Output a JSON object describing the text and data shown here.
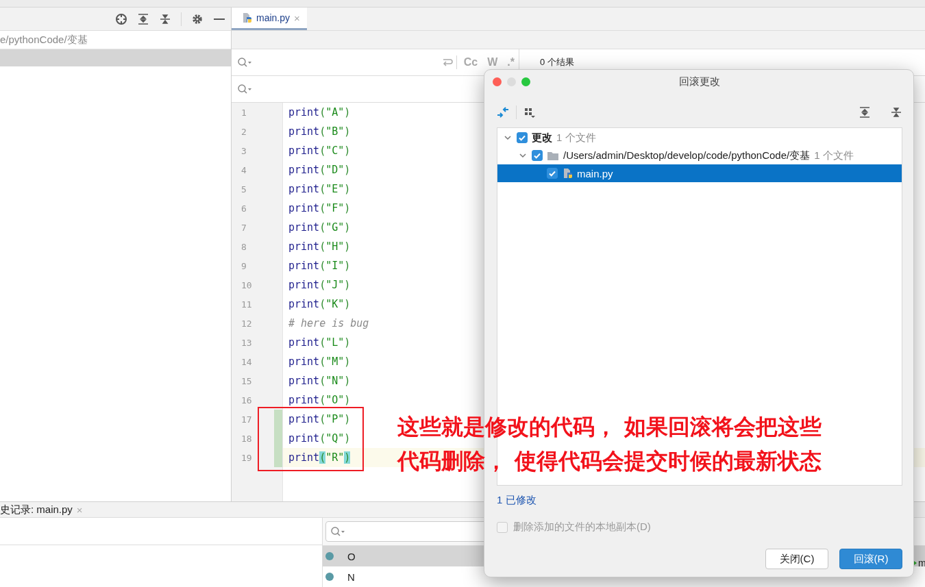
{
  "project_panel": {
    "breadcrumb": "e/pythonCode/变基"
  },
  "editor_tabs": [
    {
      "label": "main.py",
      "close_glyph": "×",
      "selected": true
    }
  ],
  "find_bar": {
    "toggles": [
      "Cc",
      "W",
      ".*"
    ],
    "result": "0 个结果"
  },
  "editor": {
    "lines": [
      {
        "number": "1",
        "kind": "code",
        "text": "print(\"A\")",
        "changed": false,
        "current": false,
        "brace_match": false
      },
      {
        "number": "2",
        "kind": "code",
        "text": "print(\"B\")",
        "changed": false,
        "current": false,
        "brace_match": false
      },
      {
        "number": "3",
        "kind": "code",
        "text": "print(\"C\")",
        "changed": false,
        "current": false,
        "brace_match": false
      },
      {
        "number": "4",
        "kind": "code",
        "text": "print(\"D\")",
        "changed": false,
        "current": false,
        "brace_match": false
      },
      {
        "number": "5",
        "kind": "code",
        "text": "print(\"E\")",
        "changed": false,
        "current": false,
        "brace_match": false
      },
      {
        "number": "6",
        "kind": "code",
        "text": "print(\"F\")",
        "changed": false,
        "current": false,
        "brace_match": false
      },
      {
        "number": "7",
        "kind": "code",
        "text": "print(\"G\")",
        "changed": false,
        "current": false,
        "brace_match": false
      },
      {
        "number": "8",
        "kind": "code",
        "text": "print(\"H\")",
        "changed": false,
        "current": false,
        "brace_match": false
      },
      {
        "number": "9",
        "kind": "code",
        "text": "print(\"I\")",
        "changed": false,
        "current": false,
        "brace_match": false
      },
      {
        "number": "10",
        "kind": "code",
        "text": "print(\"J\")",
        "changed": false,
        "current": false,
        "brace_match": false
      },
      {
        "number": "11",
        "kind": "code",
        "text": "print(\"K\")",
        "changed": false,
        "current": false,
        "brace_match": false
      },
      {
        "number": "12",
        "kind": "comment",
        "text": "# here is bug",
        "changed": false,
        "current": false
      },
      {
        "number": "13",
        "kind": "code",
        "text": "print(\"L\")",
        "changed": false,
        "current": false,
        "brace_match": false
      },
      {
        "number": "14",
        "kind": "code",
        "text": "print(\"M\")",
        "changed": false,
        "current": false,
        "brace_match": false
      },
      {
        "number": "15",
        "kind": "code",
        "text": "print(\"N\")",
        "changed": false,
        "current": false,
        "brace_match": false
      },
      {
        "number": "16",
        "kind": "code",
        "text": "print(\"O\")",
        "changed": false,
        "current": false,
        "brace_match": false
      },
      {
        "number": "17",
        "kind": "code",
        "text": "print(\"P\")",
        "changed": true,
        "current": false,
        "brace_match": false
      },
      {
        "number": "18",
        "kind": "code",
        "text": "print(\"Q\")",
        "changed": true,
        "current": false,
        "brace_match": false
      },
      {
        "number": "19",
        "kind": "code",
        "text": "print(\"R\")",
        "changed": true,
        "current": true,
        "brace_match": true
      }
    ]
  },
  "history_panel": {
    "tab": "史记录: main.py",
    "close_glyph": "×",
    "commits": [
      {
        "message": "O",
        "selected": true
      },
      {
        "message": "N",
        "selected": false
      }
    ]
  },
  "dialog": {
    "title": "回滚更改",
    "tree": [
      {
        "kind": "group",
        "label": "更改",
        "count": "1 个文件",
        "checked": true,
        "expanded": true,
        "selected": false,
        "children": [
          {
            "kind": "folder",
            "label": "/Users/admin/Desktop/develop/code/pythonCode/变基",
            "count": "1 个文件",
            "checked": true,
            "expanded": true,
            "selected": false,
            "children": [
              {
                "kind": "file",
                "label": "main.py",
                "checked": true,
                "selected": true
              }
            ]
          }
        ]
      }
    ],
    "summary_link": "1 已修改",
    "delete_option": {
      "label": "删除添加的文件的本地副本(D)",
      "checked": false,
      "disabled": true
    },
    "buttons": [
      {
        "label": "关闭(C)",
        "kind": "default"
      },
      {
        "label": "回滚(R)",
        "kind": "primary"
      }
    ]
  },
  "annotation": {
    "lines": [
      "这些就是修改的代码， 如果回滚将会把这些",
      "代码删除， 使得代码会提交时候的最新状态"
    ]
  },
  "edge_text": "m"
}
